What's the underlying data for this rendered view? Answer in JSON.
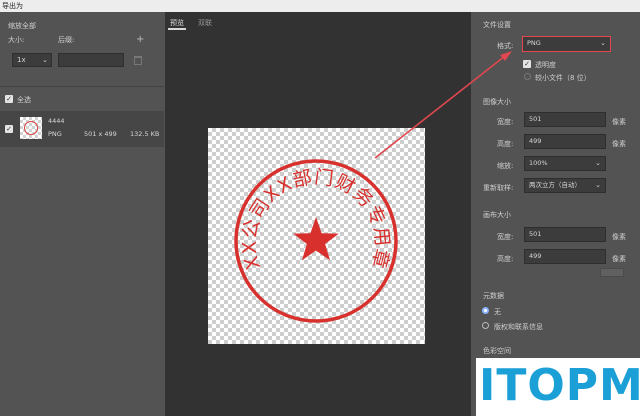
{
  "window": {
    "title": "导出为"
  },
  "left": {
    "scale_all_label": "缩放全部",
    "size_label": "大小:",
    "suffix_label": "后缀:",
    "add_symbol": "+",
    "scale_value": "1x",
    "suffix_value": "",
    "select_all_label": "全选",
    "asset": {
      "name": "4444",
      "format": "PNG",
      "dimensions": "501 x 499",
      "filesize": "132.5 KB"
    }
  },
  "center": {
    "tab_preview": "预览",
    "tab_other": "双联",
    "stamp_text": "XX公司XX部门财务专用章"
  },
  "right": {
    "file_settings": "文件设置",
    "format_label": "格式:",
    "format_value": "PNG",
    "transparency_label": "透明度",
    "smaller_file_label": "较小文件（8 位）",
    "image_size_title": "图像大小",
    "width_label": "宽度:",
    "width_value": "501",
    "height_label": "高度:",
    "height_value": "499",
    "unit_px": "像素",
    "scale_label": "缩放:",
    "scale_value": "100%",
    "resample_label": "重新取样:",
    "resample_value": "两次立方（自动）",
    "canvas_size_title": "画布大小",
    "canvas_width_label": "宽度:",
    "canvas_width_value": "501",
    "canvas_height_label": "高度:",
    "canvas_height_value": "499",
    "metadata_title": "元数据",
    "meta_none": "无",
    "meta_copyright": "版权和联系信息",
    "color_space_title": "色彩空间"
  },
  "watermark": {
    "text": "ITOPM"
  },
  "colors": {
    "stamp_red": "#d8312d",
    "arrow_red": "#e0474f",
    "logo_blue": "#1a9fd6"
  }
}
